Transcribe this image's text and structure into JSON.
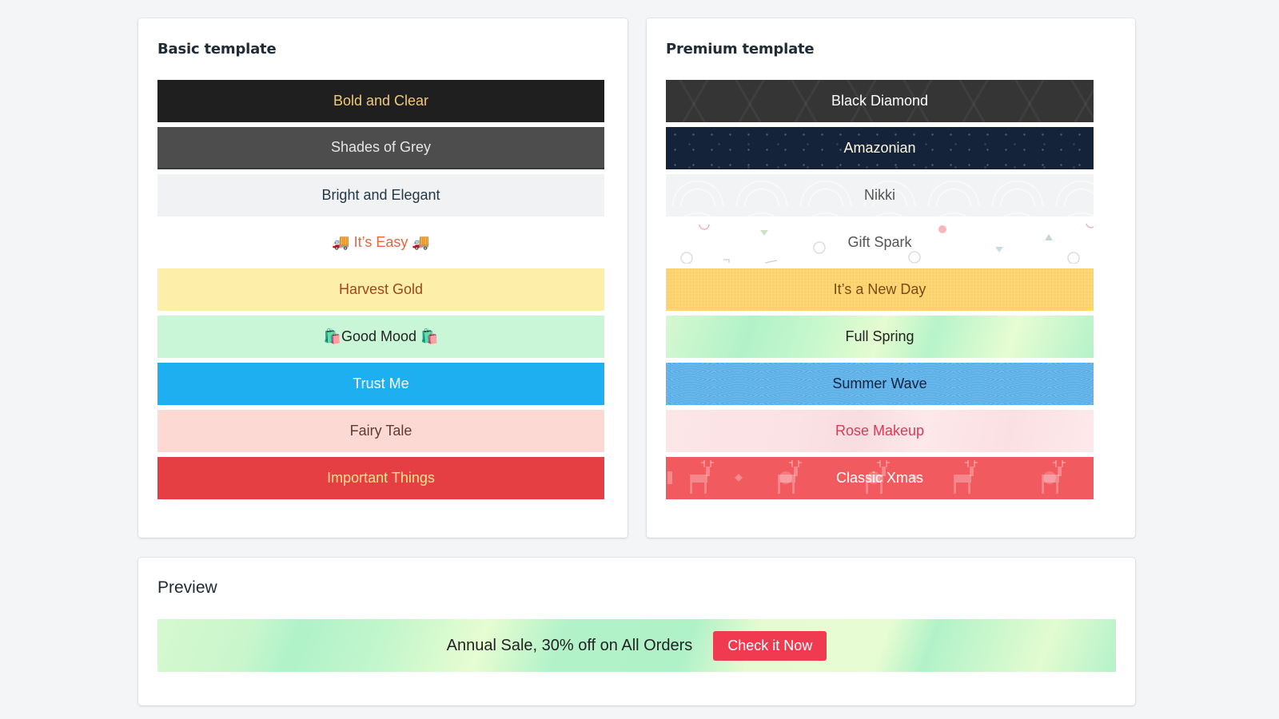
{
  "basic": {
    "title": "Basic template",
    "items": [
      {
        "label": "Bold and Clear",
        "bg": "#1f1f1f",
        "fg": "#f2c879"
      },
      {
        "label": "Shades of Grey",
        "bg": "#4d4d4d",
        "fg": "#e6e6e6"
      },
      {
        "label": "Bright and Elegant",
        "bg": "#f1f2f3",
        "fg": "#253746"
      },
      {
        "label": "🚚 It’s Easy 🚚",
        "bg": "#ffffff",
        "fg": "#e8653f"
      },
      {
        "label": "Harvest Gold",
        "bg": "#fdeeaa",
        "fg": "#a0461a"
      },
      {
        "label": "🛍️Good Mood 🛍️",
        "bg": "#c8f6d6",
        "fg": "#222222"
      },
      {
        "label": "Trust Me",
        "bg": "#1eaff0",
        "fg": "#ffffff"
      },
      {
        "label": "Fairy Tale",
        "bg": "#fdd9d4",
        "fg": "#5d3b36"
      },
      {
        "label": "Important Things",
        "bg": "#e63f43",
        "fg": "#fde08b"
      }
    ]
  },
  "premium": {
    "title": "Premium template",
    "items": [
      {
        "label": "Black Diamond",
        "pattern": "geometric-lines"
      },
      {
        "label": "Amazonian",
        "pattern": "starry-night"
      },
      {
        "label": "Nikki",
        "pattern": "waves-light"
      },
      {
        "label": "Gift Spark",
        "pattern": "confetti"
      },
      {
        "label": "It’s a New Day",
        "pattern": "woven-yellow"
      },
      {
        "label": "Full Spring",
        "pattern": "low-poly-green"
      },
      {
        "label": "Summer Wave",
        "pattern": "wavy-blue"
      },
      {
        "label": "Rose Makeup",
        "pattern": "brush-pink"
      },
      {
        "label": "Classic Xmas",
        "pattern": "reindeer-knit"
      }
    ]
  },
  "preview": {
    "title": "Preview",
    "message": "Annual Sale, 30% off on All Orders",
    "button_label": "Check it Now",
    "button_color": "#f03a4f"
  }
}
